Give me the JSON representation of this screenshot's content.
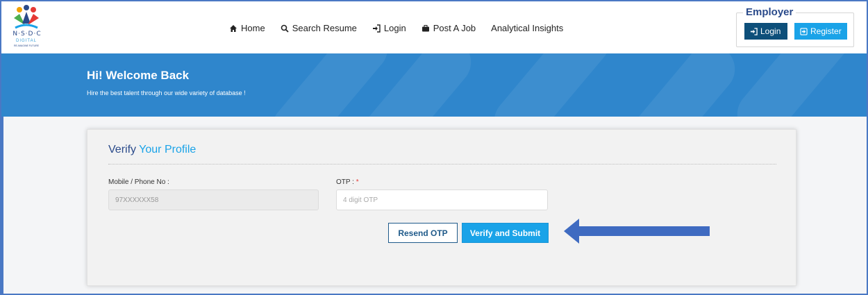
{
  "logo": {
    "brand": "N·S·D·C",
    "sub": "DIGITAL",
    "tag": "RE-IMAGINE FUTURE"
  },
  "nav": {
    "home": "Home",
    "search_resume": "Search Resume",
    "login": "Login",
    "post_job": "Post A Job",
    "analytics": "Analytical Insights"
  },
  "employer": {
    "title": "Employer",
    "login": "Login",
    "register": "Register"
  },
  "banner": {
    "title": "Hi! Welcome Back",
    "subtitle": "Hire the best talent through our wide variety of database !"
  },
  "form": {
    "title_main": "Verify",
    "title_accent": "Your Profile",
    "mobile_label": "Mobile / Phone No :",
    "mobile_value": "97XXXXXX58",
    "otp_label": "OTP :",
    "otp_required": "*",
    "otp_placeholder": "4 digit OTP",
    "resend": "Resend OTP",
    "verify": "Verify and Submit"
  },
  "colors": {
    "banner": "#2f86cc",
    "accent": "#1aa3e8",
    "navy": "#0d4f7a",
    "arrow": "#3f6bc1"
  }
}
